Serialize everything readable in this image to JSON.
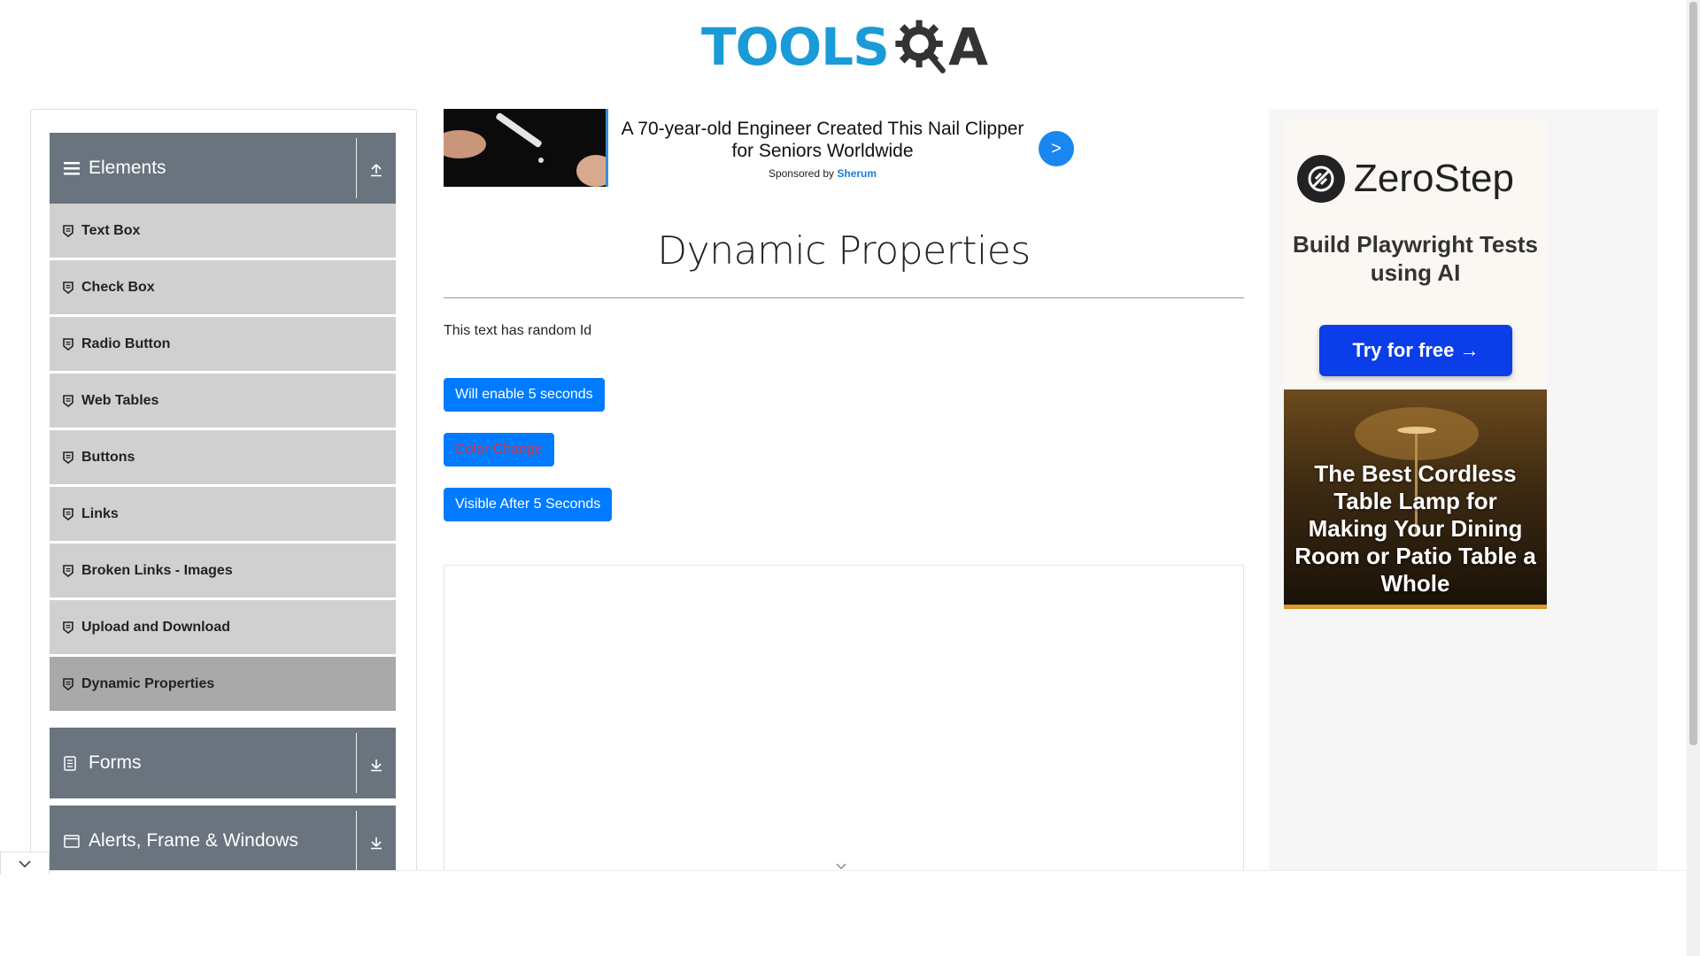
{
  "header": {
    "logo_text": "TOOLS",
    "logo_suffix": "A"
  },
  "nav": {
    "elements_group": {
      "label": "Elements"
    },
    "items": [
      {
        "label": "Text Box"
      },
      {
        "label": "Check Box"
      },
      {
        "label": "Radio Button"
      },
      {
        "label": "Web Tables"
      },
      {
        "label": "Buttons"
      },
      {
        "label": "Links"
      },
      {
        "label": "Broken Links - Images"
      },
      {
        "label": "Upload and Download"
      },
      {
        "label": "Dynamic Properties"
      }
    ],
    "forms_group": {
      "label": "Forms"
    },
    "alerts_group": {
      "label": "Alerts, Frame & Windows"
    }
  },
  "ad_top": {
    "title": "A 70-year-old Engineer Created This Nail Clipper for Seniors Worldwide",
    "sponsor_prefix": "Sponsored by",
    "sponsor_name": "Sherum",
    "arrow": ">"
  },
  "main": {
    "title": "Dynamic Properties",
    "random_text": "This text has random Id",
    "enable_button": "Will enable 5 seconds",
    "color_button": "Color Change",
    "visible_button": "Visible After 5 Seconds"
  },
  "right_ad": {
    "brand": "ZeroStep",
    "tagline": "Build Playwright Tests using AI",
    "cta": "Try for free →",
    "lamp_text": "The Best Cordless Table Lamp for Making Your Dining Room or Patio Table a Whole"
  },
  "colors": {
    "primary": "#007bff",
    "nav_group": "#6a747e",
    "nav_item": "#d0d0d0",
    "nav_active": "#a9a9a9",
    "logo_blue": "#1a9bd7",
    "color_change_text": "#dc3545"
  }
}
